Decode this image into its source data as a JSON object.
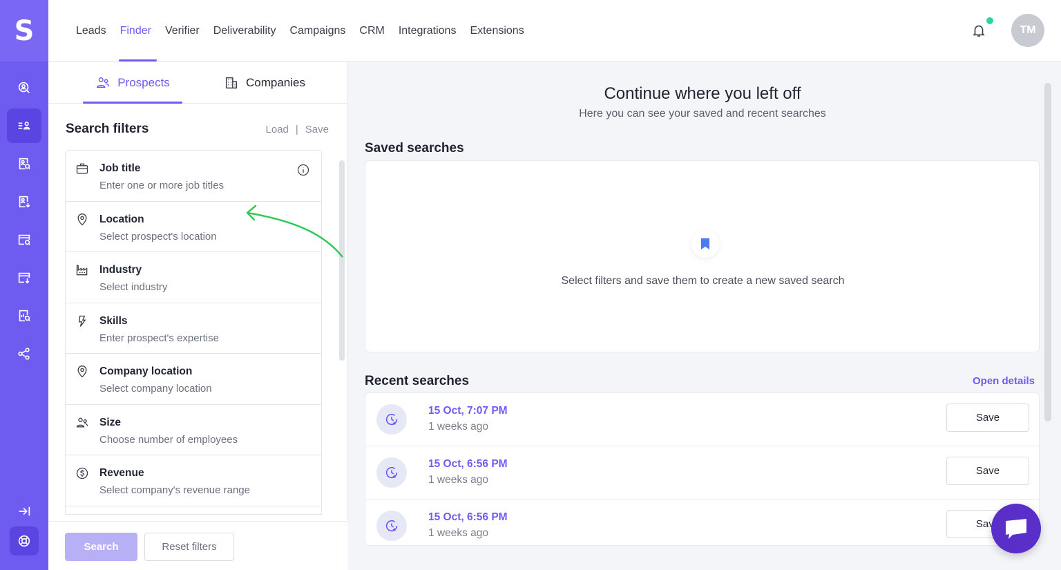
{
  "app": {
    "logo_letter": "S"
  },
  "nav": {
    "items": [
      {
        "label": "Leads",
        "active": false
      },
      {
        "label": "Finder",
        "active": true
      },
      {
        "label": "Verifier",
        "active": false
      },
      {
        "label": "Deliverability",
        "active": false
      },
      {
        "label": "Campaigns",
        "active": false
      },
      {
        "label": "CRM",
        "active": false
      },
      {
        "label": "Integrations",
        "active": false
      },
      {
        "label": "Extensions",
        "active": false
      }
    ],
    "avatar_initials": "TM",
    "notification_dot_color": "#2ed3a4"
  },
  "sidebar_icons": [
    "search-user-icon",
    "list-user-icon",
    "doc-search-icon",
    "doc-download-icon",
    "window-search-icon",
    "window-download-icon",
    "report-search-icon",
    "share-nodes-icon",
    "collapse-arrow-icon",
    "support-lifebuoy-icon"
  ],
  "tabs": {
    "prospects": "Prospects",
    "companies": "Companies"
  },
  "search_filters": {
    "title": "Search filters",
    "load": "Load",
    "separator": "|",
    "save": "Save",
    "items": [
      {
        "name": "Job title",
        "placeholder": "Enter one or more job titles",
        "icon": "briefcase-icon"
      },
      {
        "name": "Location",
        "placeholder": "Select prospect's location",
        "icon": "location-pin-icon"
      },
      {
        "name": "Industry",
        "placeholder": "Select industry",
        "icon": "factory-icon"
      },
      {
        "name": "Skills",
        "placeholder": "Enter prospect's expertise",
        "icon": "lightning-icon"
      },
      {
        "name": "Company location",
        "placeholder": "Select company location",
        "icon": "location-pin-icon"
      },
      {
        "name": "Size",
        "placeholder": "Choose number of employees",
        "icon": "people-icon"
      },
      {
        "name": "Revenue",
        "placeholder": "Select company's revenue range",
        "icon": "dollar-circle-icon"
      }
    ],
    "search_button": "Search",
    "reset_button": "Reset filters"
  },
  "main": {
    "title": "Continue where you left off",
    "subtitle": "Here you can see your saved and recent searches",
    "saved_title": "Saved searches",
    "saved_empty": "Select filters and save them to create a new saved search",
    "recent_title": "Recent searches",
    "open_details": "Open details",
    "recent": [
      {
        "date": "15 Oct, 7:07 PM",
        "ago": "1 weeks ago",
        "save": "Save"
      },
      {
        "date": "15 Oct, 6:56 PM",
        "ago": "1 weeks ago",
        "save": "Save"
      },
      {
        "date": "15 Oct, 6:56 PM",
        "ago": "1 weeks ago",
        "save": "Save"
      }
    ]
  },
  "colors": {
    "accent": "#6e5bf0",
    "rail": "#6e5bf0",
    "chat": "#5a2fc9"
  }
}
